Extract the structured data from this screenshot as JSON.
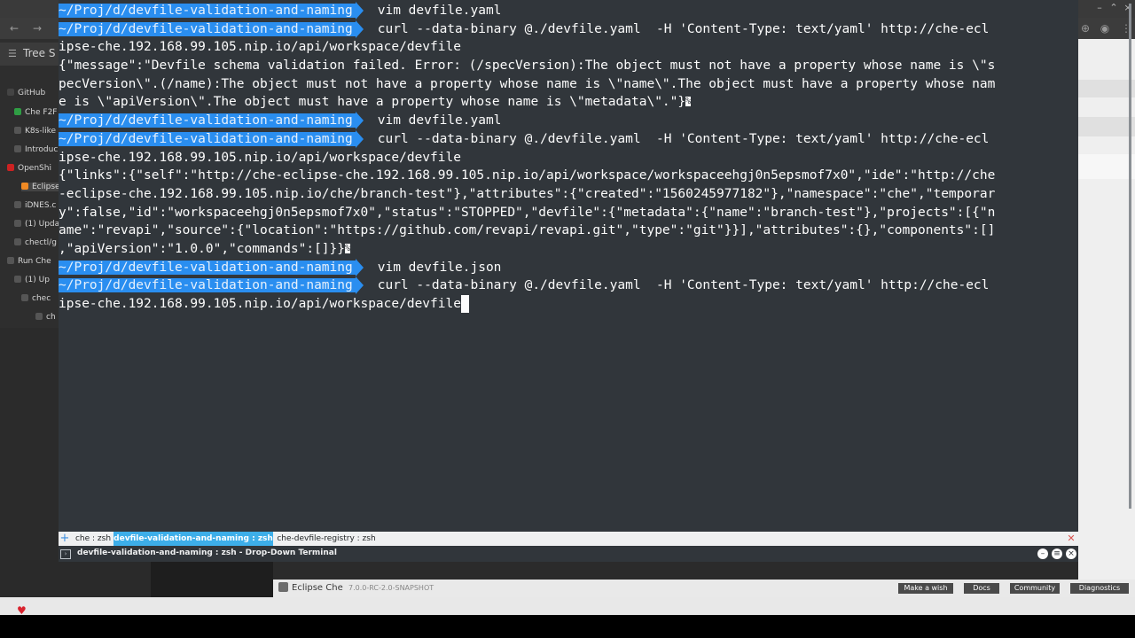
{
  "terminal": {
    "lines": [
      {
        "prompt": "~/Proj/d/devfile-validation-and-naming",
        "cmd": "vim devfile.yaml"
      },
      {
        "prompt": "~/Proj/d/devfile-validation-and-naming",
        "cmd": "curl --data-binary @./devfile.yaml  -H 'Content-Type: text/yaml' http://che-ecl"
      },
      {
        "text": "ipse-che.192.168.99.105.nip.io/api/workspace/devfile"
      },
      {
        "text": "{\"message\":\"Devfile schema validation failed. Error: (/specVersion):The object must not have a property whose name is \\\"s"
      },
      {
        "text": "pecVersion\\\".(/name):The object must not have a property whose name is \\\"name\\\".The object must have a property whose nam"
      },
      {
        "text": "e is \\\"apiVersion\\\".The object must have a property whose name is \\\"metadata\\\".\"}",
        "eol": "%"
      },
      {
        "prompt": "~/Proj/d/devfile-validation-and-naming",
        "cmd": "vim devfile.yaml"
      },
      {
        "prompt": "~/Proj/d/devfile-validation-and-naming",
        "cmd": "curl --data-binary @./devfile.yaml  -H 'Content-Type: text/yaml' http://che-ecl"
      },
      {
        "text": "ipse-che.192.168.99.105.nip.io/api/workspace/devfile"
      },
      {
        "text": "{\"links\":{\"self\":\"http://che-eclipse-che.192.168.99.105.nip.io/api/workspace/workspaceehgj0n5epsmof7x0\",\"ide\":\"http://che"
      },
      {
        "text": "-eclipse-che.192.168.99.105.nip.io/che/branch-test\"},\"attributes\":{\"created\":\"1560245977182\"},\"namespace\":\"che\",\"temporar"
      },
      {
        "text": "y\":false,\"id\":\"workspaceehgj0n5epsmof7x0\",\"status\":\"STOPPED\",\"devfile\":{\"metadata\":{\"name\":\"branch-test\"},\"projects\":[{\"n"
      },
      {
        "text": "ame\":\"revapi\",\"source\":{\"location\":\"https://github.com/revapi/revapi.git\",\"type\":\"git\"}}],\"attributes\":{},\"components\":[]"
      },
      {
        "text": ",\"apiVersion\":\"1.0.0\",\"commands\":[]}}",
        "eol": "%"
      },
      {
        "prompt": "~/Proj/d/devfile-validation-and-naming",
        "cmd": "vim devfile.json"
      },
      {
        "prompt": "~/Proj/d/devfile-validation-and-naming",
        "cmd": "curl --data-binary @./devfile.yaml  -H 'Content-Type: text/yaml' http://che-ecl"
      },
      {
        "text": "ipse-che.192.168.99.105.nip.io/api/workspace/devfile",
        "cursor": true
      }
    ]
  },
  "tabs": [
    {
      "label": "che : zsh",
      "active": false
    },
    {
      "label": "devfile-validation-and-naming : zsh",
      "active": true
    },
    {
      "label": "che-devfile-registry : zsh",
      "active": false
    }
  ],
  "window": {
    "title": "devfile-validation-and-naming : zsh - Drop-Down Terminal"
  },
  "background": {
    "sidebar_title": "Tree S",
    "sidebar_items": [
      {
        "label": "GitHub",
        "color": "#444444"
      },
      {
        "label": "Che F2F",
        "color": "#2f9e44"
      },
      {
        "label": "K8s-like",
        "color": "#555555"
      },
      {
        "label": "Introduc",
        "color": "#555555"
      },
      {
        "label": "OpenShi",
        "color": "#cc2222"
      },
      {
        "label": "Eclipse",
        "color": "#f08a24"
      },
      {
        "label": "iDNES.c",
        "color": "#555555"
      },
      {
        "label": "(1) Upda",
        "color": "#555555"
      },
      {
        "label": "chectl/g",
        "color": "#555555"
      },
      {
        "label": "Run Che",
        "color": "#555555"
      },
      {
        "label": "(1) Up",
        "color": "#555555"
      },
      {
        "label": "chec",
        "color": "#555555"
      },
      {
        "label": "ch",
        "color": "#555555"
      }
    ],
    "status_bar": {
      "product": "Eclipse Che",
      "version": "7.0.0-RC-2.0-SNAPSHOT",
      "buttons": [
        "Make a wish",
        "Docs",
        "Community",
        "Diagnostics"
      ]
    }
  }
}
